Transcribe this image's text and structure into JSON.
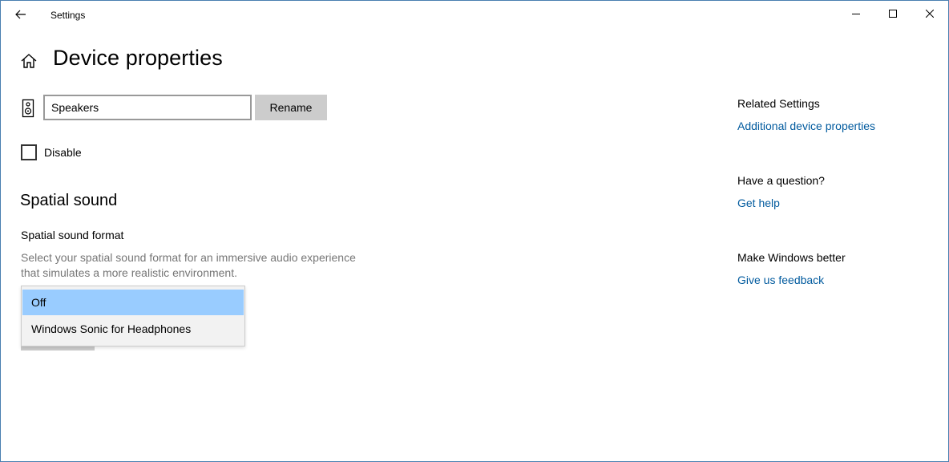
{
  "window": {
    "title": "Settings",
    "controls": {
      "minimize_icon": "minimize-icon",
      "maximize_icon": "maximize-icon",
      "close_icon": "close-icon"
    }
  },
  "header": {
    "title": "Device properties",
    "home_icon": "home-icon",
    "back_icon": "back-arrow-icon"
  },
  "device": {
    "icon": "speaker-icon",
    "name_value": "Speakers",
    "rename_label": "Rename"
  },
  "disable": {
    "label": "Disable",
    "checked": false
  },
  "spatial": {
    "section_title": "Spatial sound",
    "field_label": "Spatial sound format",
    "description_line1": "Select your spatial sound format for an immersive audio experience",
    "description_line2": "that simulates a more realistic environment.",
    "options": [
      "Off",
      "Windows Sonic for Headphones"
    ],
    "selected": "Off"
  },
  "related": {
    "sections": [
      {
        "heading": "Related Settings",
        "link": "Additional device properties"
      },
      {
        "heading": "Have a question?",
        "link": "Get help"
      },
      {
        "heading": "Make Windows better",
        "link": "Give us feedback"
      }
    ]
  },
  "colors": {
    "accent_link": "#005a9e",
    "selection": "#99ccff",
    "window_border": "#4a7fb0",
    "button_gray": "#cccccc",
    "muted_text": "#767676"
  }
}
